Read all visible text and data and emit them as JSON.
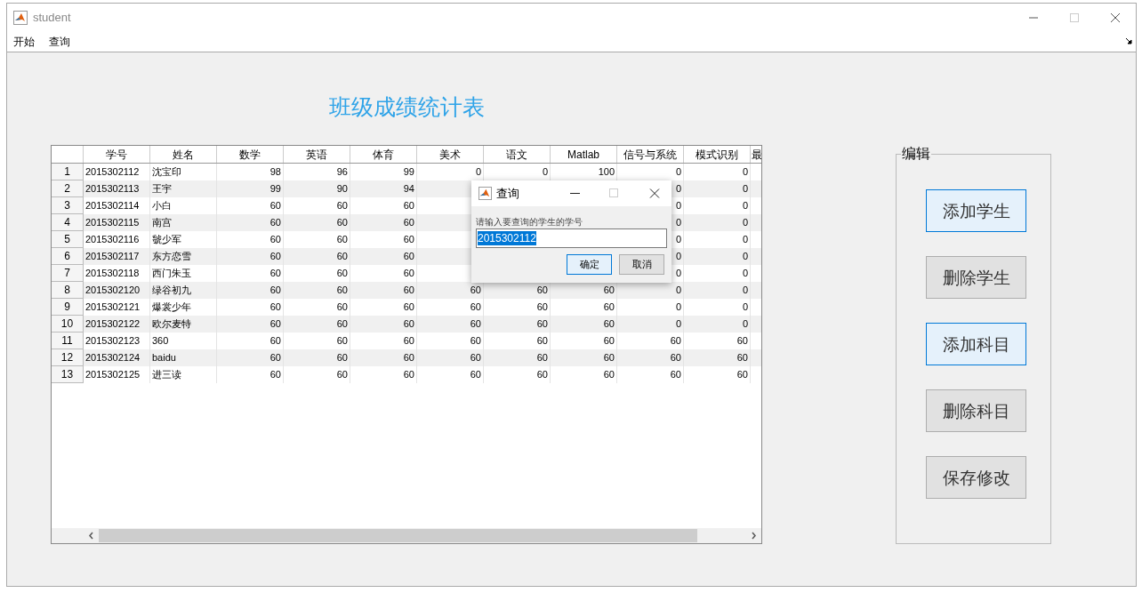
{
  "window": {
    "title": "student"
  },
  "menu": [
    "开始",
    "查询"
  ],
  "heading": "班级成绩统计表",
  "table": {
    "columns": [
      {
        "label": "学号",
        "kind": "text"
      },
      {
        "label": "姓名",
        "kind": "text"
      },
      {
        "label": "数学",
        "kind": "number"
      },
      {
        "label": "英语",
        "kind": "number"
      },
      {
        "label": "体育",
        "kind": "number"
      },
      {
        "label": "美术",
        "kind": "number"
      },
      {
        "label": "语文",
        "kind": "number"
      },
      {
        "label": "Matlab",
        "kind": "number"
      },
      {
        "label": "信号与系统",
        "kind": "number"
      },
      {
        "label": "模式识别",
        "kind": "number"
      },
      {
        "label": "最"
      }
    ],
    "rows": [
      {
        "number": "1",
        "cells": [
          "2015302112",
          "沈宝印",
          "98",
          "96",
          "99",
          "0",
          "0",
          "100",
          "0",
          "0"
        ]
      },
      {
        "number": "2",
        "cells": [
          "2015302113",
          "王宇",
          "99",
          "90",
          "94",
          null,
          null,
          null,
          "0",
          "0"
        ]
      },
      {
        "number": "3",
        "cells": [
          "2015302114",
          "小白",
          "60",
          "60",
          "60",
          null,
          null,
          null,
          "0",
          "0"
        ]
      },
      {
        "number": "4",
        "cells": [
          "2015302115",
          "南宫",
          "60",
          "60",
          "60",
          null,
          null,
          null,
          "0",
          "0"
        ]
      },
      {
        "number": "5",
        "cells": [
          "2015302116",
          "虢少军",
          "60",
          "60",
          "60",
          null,
          null,
          null,
          "0",
          "0"
        ]
      },
      {
        "number": "6",
        "cells": [
          "2015302117",
          "东方恋雪",
          "60",
          "60",
          "60",
          null,
          null,
          null,
          "0",
          "0"
        ]
      },
      {
        "number": "7",
        "cells": [
          "2015302118",
          "西门朱玉",
          "60",
          "60",
          "60",
          null,
          null,
          null,
          "0",
          "0"
        ]
      },
      {
        "number": "8",
        "cells": [
          "2015302120",
          "绿谷初九",
          "60",
          "60",
          "60",
          "60",
          "60",
          "60",
          "0",
          "0"
        ]
      },
      {
        "number": "9",
        "cells": [
          "2015302121",
          "爆裳少年",
          "60",
          "60",
          "60",
          "60",
          "60",
          "60",
          "0",
          "0"
        ]
      },
      {
        "number": "10",
        "cells": [
          "2015302122",
          "欧尔麦特",
          "60",
          "60",
          "60",
          "60",
          "60",
          "60",
          "0",
          "0"
        ]
      },
      {
        "number": "11",
        "cells": [
          "2015302123",
          "360",
          "60",
          "60",
          "60",
          "60",
          "60",
          "60",
          "60",
          "60"
        ]
      },
      {
        "number": "12",
        "cells": [
          "2015302124",
          "baidu",
          "60",
          "60",
          "60",
          "60",
          "60",
          "60",
          "60",
          "60"
        ]
      },
      {
        "number": "13",
        "cells": [
          "2015302125",
          "进三读",
          "60",
          "60",
          "60",
          "60",
          "60",
          "60",
          "60",
          "60"
        ]
      }
    ]
  },
  "edit_panel": {
    "title": "编辑",
    "buttons": [
      {
        "label": "添加学生",
        "highlighted": true
      },
      {
        "label": "删除学生",
        "highlighted": false
      },
      {
        "label": "添加科目",
        "highlighted": true
      },
      {
        "label": "删除科目",
        "highlighted": false
      },
      {
        "label": "保存修改",
        "highlighted": false
      }
    ]
  },
  "dialog": {
    "title": "查询",
    "prompt": "请输入要查询的学生的学号",
    "value": "2015302112",
    "value_selected": true,
    "buttons": [
      {
        "label": "确定",
        "default": true
      },
      {
        "label": "取消",
        "default": false
      }
    ]
  }
}
